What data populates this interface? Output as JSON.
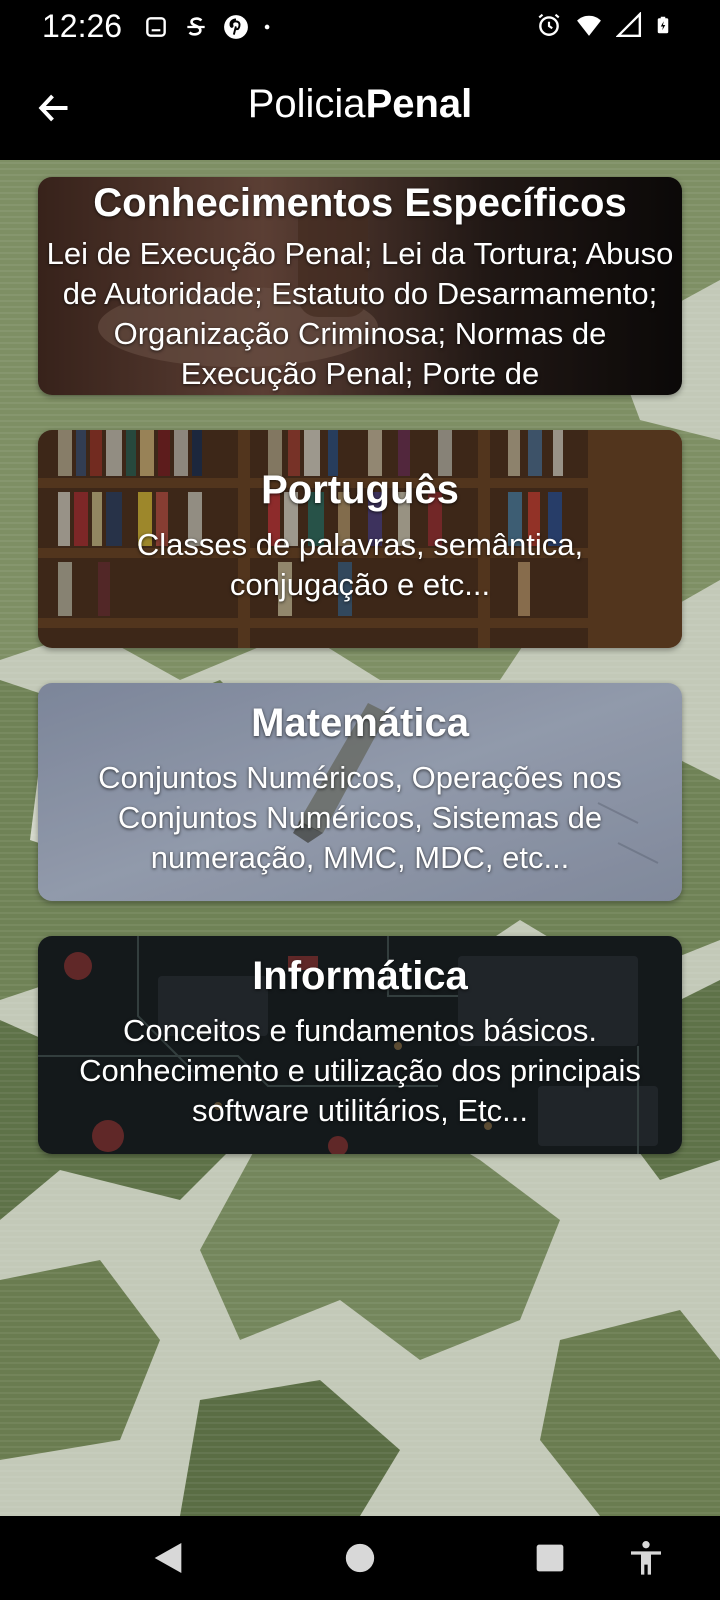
{
  "status_bar": {
    "time": "12:26",
    "left_icons": [
      "notification-icon",
      "s-app-icon",
      "pinterest-icon",
      "dot-icon"
    ],
    "right_icons": [
      "alarm-icon",
      "wifi-icon",
      "signal-icon",
      "battery-icon"
    ]
  },
  "app_bar": {
    "title_regular": "Policia",
    "title_bold": "Penal",
    "back_icon": "arrow-left-icon"
  },
  "cards": [
    {
      "title": "Conhecimentos Específicos",
      "description": "Lei de Execução Penal; Lei da Tortura; Abuso de Autoridade; Estatuto do Desarmamento; Organização Criminosa; Normas de Execução Penal; Porte de"
    },
    {
      "title": "Português",
      "description": "Classes de palavras, semântica, conjugação e etc..."
    },
    {
      "title": "Matemática",
      "description": "Conjuntos Numéricos, Operações nos Conjuntos Numéricos, Sistemas de numeração, MMC, MDC, etc..."
    },
    {
      "title": "Informática",
      "description": "Conceitos e fundamentos básicos. Conhecimento e utilização dos principais software utilitários, Etc..."
    }
  ],
  "nav_bar": {
    "buttons": [
      "back-triangle-icon",
      "home-circle-icon",
      "recents-square-icon",
      "accessibility-icon"
    ]
  },
  "colors": {
    "status_bar_bg": "#000000",
    "app_bar_bg": "#000000",
    "camo_light": "#c9cfc0",
    "camo_mid": "#8a9a72",
    "camo_dark": "#4f6038"
  }
}
